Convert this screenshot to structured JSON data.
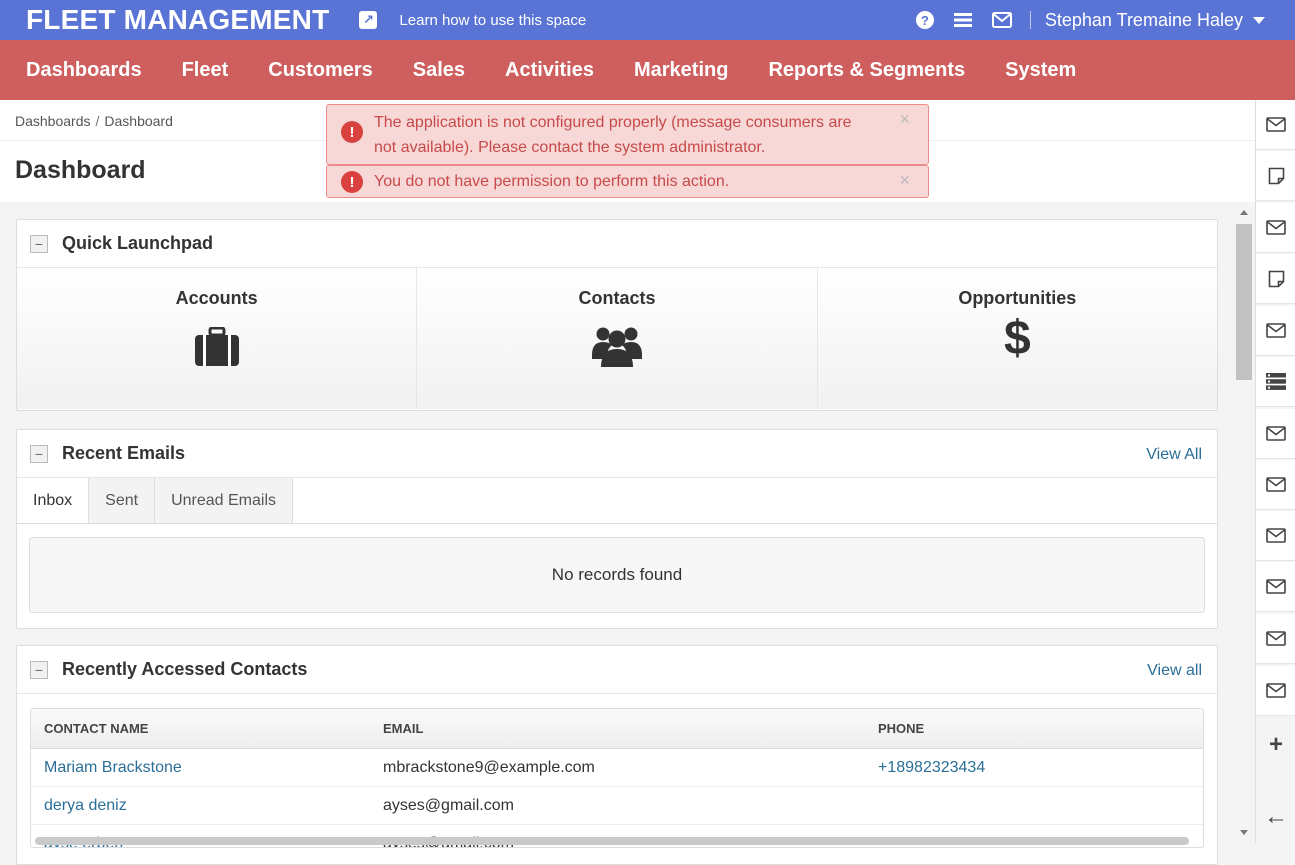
{
  "header": {
    "brand": "FLEET MANAGEMENT",
    "learn_link": "Learn how to use this space",
    "user_name": "Stephan Tremaine Haley",
    "help_glyph": "?",
    "icons": [
      "share-icon",
      "help-icon",
      "menu-icon",
      "envelope-icon",
      "chevron-down-icon"
    ]
  },
  "menu": [
    "Dashboards",
    "Fleet",
    "Customers",
    "Sales",
    "Activities",
    "Marketing",
    "Reports & Segments",
    "System"
  ],
  "breadcrumb": {
    "root": "Dashboards",
    "separator": "/",
    "current": "Dashboard"
  },
  "page_title": "Dashboard",
  "alerts": [
    {
      "line1": "The application is not configured properly (message consumers are",
      "line2": "not available). Please contact the system administrator.",
      "close": "×"
    },
    {
      "line1": "You do not have permission to perform this action.",
      "close": "×"
    }
  ],
  "quick_launchpad": {
    "title": "Quick Launchpad",
    "collapse_glyph": "−",
    "items": [
      {
        "label": "Accounts",
        "icon": "briefcase-icon"
      },
      {
        "label": "Contacts",
        "icon": "users-icon"
      },
      {
        "label": "Opportunities",
        "icon": "dollar-icon",
        "glyph": "$"
      }
    ]
  },
  "recent_emails": {
    "title": "Recent Emails",
    "view_all": "View All",
    "tabs": [
      "Inbox",
      "Sent",
      "Unread Emails"
    ],
    "active_tab": "Inbox",
    "empty_text": "No records found"
  },
  "recent_contacts": {
    "title": "Recently Accessed Contacts",
    "view_all": "View all",
    "columns": [
      "CONTACT NAME",
      "EMAIL",
      "PHONE"
    ],
    "rows": [
      {
        "name": "Mariam Brackstone",
        "email": "mbrackstone9@example.com",
        "phone": "+18982323434"
      },
      {
        "name": "derya deniz",
        "email": "ayses@gmail.com",
        "phone": ""
      },
      {
        "name": "ayse erben",
        "email": "ayses@gmail.com",
        "phone": ""
      }
    ]
  },
  "sidebar": {
    "items": [
      "envelope-icon",
      "note-icon",
      "envelope-icon",
      "note-icon",
      "envelope-icon",
      "tasks-icon",
      "envelope-icon",
      "envelope-icon",
      "envelope-icon",
      "envelope-icon",
      "envelope-icon",
      "envelope-icon"
    ],
    "add_glyph": "+",
    "back_glyph": "←"
  },
  "colors": {
    "header": "#5a74d6",
    "menu": "#cf5f5f",
    "alert_bg": "#f8d7d7",
    "alert_text": "#c74a4a",
    "link": "#2b6e98"
  }
}
